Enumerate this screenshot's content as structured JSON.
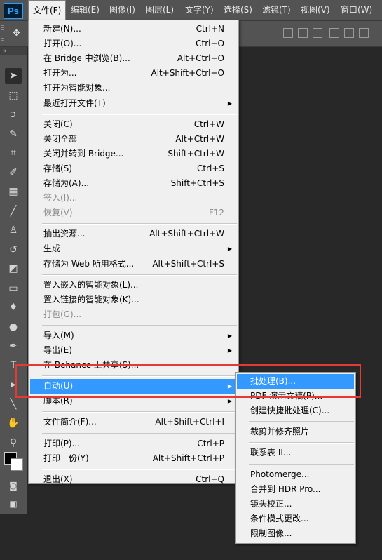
{
  "app": {
    "logo": "Ps"
  },
  "menubar": [
    {
      "label": "文件(F)",
      "active": true
    },
    {
      "label": "编辑(E)"
    },
    {
      "label": "图像(I)"
    },
    {
      "label": "图层(L)"
    },
    {
      "label": "文字(Y)"
    },
    {
      "label": "选择(S)"
    },
    {
      "label": "滤镜(T)"
    },
    {
      "label": "视图(V)"
    },
    {
      "label": "窗口(W)"
    }
  ],
  "tools_header": "»",
  "file_menu": [
    {
      "label": "新建(N)...",
      "shortcut": "Ctrl+N"
    },
    {
      "label": "打开(O)...",
      "shortcut": "Ctrl+O"
    },
    {
      "label": "在 Bridge 中浏览(B)...",
      "shortcut": "Alt+Ctrl+O"
    },
    {
      "label": "打开为...",
      "shortcut": "Alt+Shift+Ctrl+O"
    },
    {
      "label": "打开为智能对象..."
    },
    {
      "label": "最近打开文件(T)",
      "submenu": true
    },
    {
      "sep": true
    },
    {
      "label": "关闭(C)",
      "shortcut": "Ctrl+W"
    },
    {
      "label": "关闭全部",
      "shortcut": "Alt+Ctrl+W"
    },
    {
      "label": "关闭并转到 Bridge...",
      "shortcut": "Shift+Ctrl+W"
    },
    {
      "label": "存储(S)",
      "shortcut": "Ctrl+S"
    },
    {
      "label": "存储为(A)...",
      "shortcut": "Shift+Ctrl+S"
    },
    {
      "label": "签入(I)...",
      "disabled": true
    },
    {
      "label": "恢复(V)",
      "shortcut": "F12",
      "disabled": true
    },
    {
      "sep": true
    },
    {
      "label": "抽出资源...",
      "shortcut": "Alt+Shift+Ctrl+W"
    },
    {
      "label": "生成",
      "submenu": true
    },
    {
      "label": "存储为 Web 所用格式...",
      "shortcut": "Alt+Shift+Ctrl+S"
    },
    {
      "sep": true
    },
    {
      "label": "置入嵌入的智能对象(L)..."
    },
    {
      "label": "置入链接的智能对象(K)..."
    },
    {
      "label": "打包(G)...",
      "disabled": true
    },
    {
      "sep": true
    },
    {
      "label": "导入(M)",
      "submenu": true
    },
    {
      "label": "导出(E)",
      "submenu": true
    },
    {
      "label": "在 Behance 上共享(S)..."
    },
    {
      "sep": true
    },
    {
      "label": "自动(U)",
      "submenu": true,
      "highlighted": true
    },
    {
      "label": "脚本(R)",
      "submenu": true
    },
    {
      "sep": true
    },
    {
      "label": "文件简介(F)...",
      "shortcut": "Alt+Shift+Ctrl+I"
    },
    {
      "sep": true
    },
    {
      "label": "打印(P)...",
      "shortcut": "Ctrl+P"
    },
    {
      "label": "打印一份(Y)",
      "shortcut": "Alt+Shift+Ctrl+P"
    },
    {
      "sep": true
    },
    {
      "label": "退出(X)",
      "shortcut": "Ctrl+Q"
    }
  ],
  "automate_submenu": [
    {
      "label": "批处理(B)...",
      "highlighted": true
    },
    {
      "label": "PDF 演示文稿(P)..."
    },
    {
      "label": "创建快捷批处理(C)..."
    },
    {
      "sep": true
    },
    {
      "label": "裁剪并修齐照片"
    },
    {
      "sep": true
    },
    {
      "label": "联系表 II..."
    },
    {
      "sep": true
    },
    {
      "label": "Photomerge..."
    },
    {
      "label": "合并到 HDR Pro..."
    },
    {
      "label": "镜头校正..."
    },
    {
      "label": "条件模式更改..."
    },
    {
      "label": "限制图像..."
    }
  ],
  "tools": [
    {
      "icon": "move-tool-icon",
      "glyph": "➤"
    },
    {
      "icon": "marquee-tool-icon",
      "glyph": "⬚"
    },
    {
      "icon": "lasso-tool-icon",
      "glyph": "ↄ"
    },
    {
      "icon": "quick-select-tool-icon",
      "glyph": "✎"
    },
    {
      "icon": "crop-tool-icon",
      "glyph": "⌗"
    },
    {
      "icon": "eyedropper-tool-icon",
      "glyph": "✐"
    },
    {
      "icon": "healing-brush-tool-icon",
      "glyph": "▦"
    },
    {
      "icon": "brush-tool-icon",
      "glyph": "╱"
    },
    {
      "icon": "clone-stamp-tool-icon",
      "glyph": "♙"
    },
    {
      "icon": "history-brush-tool-icon",
      "glyph": "↺"
    },
    {
      "icon": "eraser-tool-icon",
      "glyph": "◩"
    },
    {
      "icon": "gradient-tool-icon",
      "glyph": "▭"
    },
    {
      "icon": "blur-tool-icon",
      "glyph": "♦"
    },
    {
      "icon": "dodge-tool-icon",
      "glyph": "●"
    },
    {
      "icon": "pen-tool-icon",
      "glyph": "✒"
    },
    {
      "icon": "type-tool-icon",
      "glyph": "T"
    },
    {
      "icon": "path-select-tool-icon",
      "glyph": "▸"
    },
    {
      "icon": "line-tool-icon",
      "glyph": "╲"
    },
    {
      "icon": "hand-tool-icon",
      "glyph": "✋"
    },
    {
      "icon": "zoom-tool-icon",
      "glyph": "⚲"
    }
  ],
  "colors": {
    "highlight": "#3399ff",
    "menu_bg": "#f0f0f0",
    "callout": "#e53935"
  }
}
